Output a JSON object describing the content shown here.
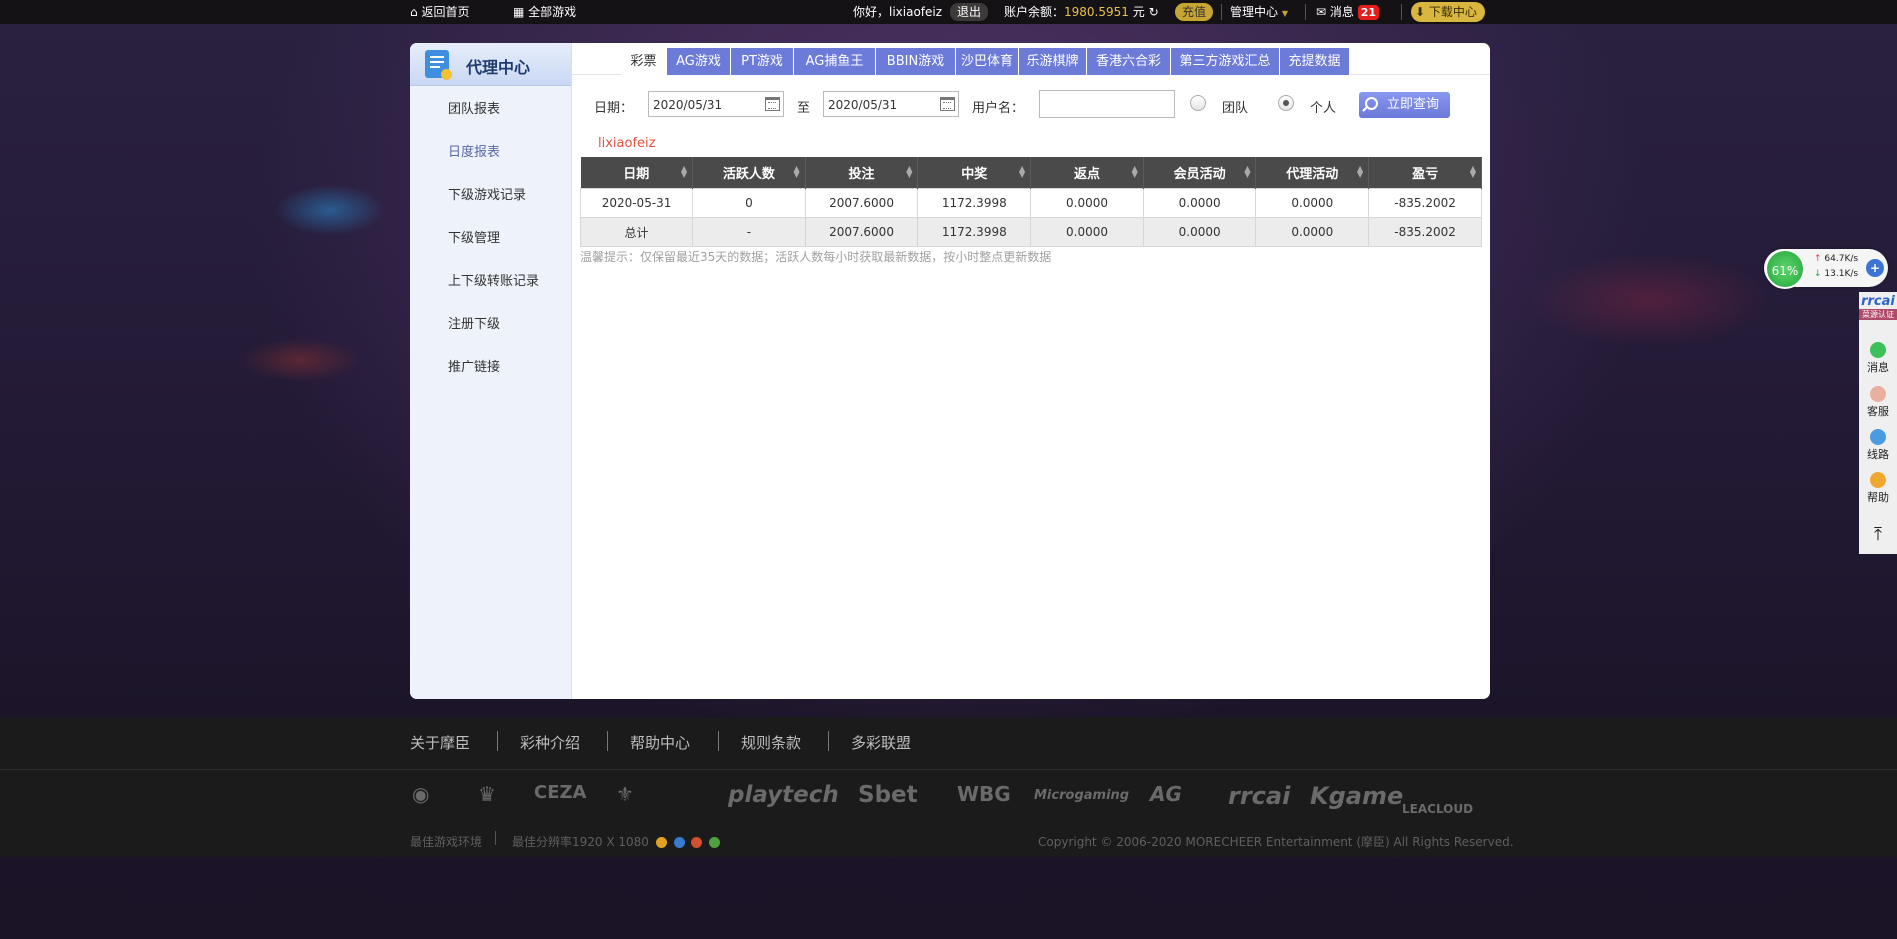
{
  "topbar": {
    "home": "返回首页",
    "all_games": "全部游戏",
    "greeting": "你好，lixiaofeiz",
    "logout": "退出",
    "balance_label": "账户余额：",
    "balance_value": "1980.5951",
    "balance_unit": "元",
    "charge": "充值",
    "manage": "管理中心",
    "messages": "消息",
    "message_count": "21",
    "download": "下载中心"
  },
  "sidebar": {
    "title": "代理中心",
    "items": [
      "团队报表",
      "日度报表",
      "下级游戏记录",
      "下级管理",
      "上下级转账记录",
      "注册下级",
      "推广链接"
    ],
    "active_index": 1
  },
  "tabs": [
    "彩票",
    "AG游戏",
    "PT游戏",
    "AG捕鱼王",
    "BBIN游戏",
    "沙巴体育",
    "乐游棋牌",
    "香港六合彩",
    "第三方游戏汇总",
    "充提数据"
  ],
  "filter": {
    "date_label": "日期：",
    "date_from": "2020/05/31",
    "to_label": "至",
    "date_to": "2020/05/31",
    "username_label": "用户名：",
    "username_value": "",
    "radio_team": "团队",
    "radio_personal": "个人",
    "selected": "个人",
    "query_button": "立即查询"
  },
  "user_link": "lixiaofeiz",
  "table": {
    "columns": [
      "日期",
      "活跃人数",
      "投注",
      "中奖",
      "返点",
      "会员活动",
      "代理活动",
      "盈亏"
    ],
    "rows": [
      [
        "2020-05-31",
        "0",
        "2007.6000",
        "1172.3998",
        "0.0000",
        "0.0000",
        "0.0000",
        "-835.2002"
      ]
    ],
    "total": [
      "总计",
      "-",
      "2007.6000",
      "1172.3998",
      "0.0000",
      "0.0000",
      "0.0000",
      "-835.2002"
    ]
  },
  "tip": "温馨提示：仅保留最近35天的数据；活跃人数每小时获取最新数据，按小时整点更新数据",
  "speed_widget": {
    "percent": "61%",
    "up": "64.7K/s",
    "down": "13.1K/s"
  },
  "rightbar": {
    "brand": "rrcai",
    "brand_sub": "菜源认证",
    "items": [
      "消息",
      "客服",
      "线路",
      "帮助"
    ]
  },
  "footer": {
    "links": [
      "关于摩臣",
      "彩种介绍",
      "帮助中心",
      "规则条款",
      "多彩联盟"
    ],
    "logos": [
      "CEZA",
      "playtech",
      "Sbet",
      "WBG",
      "Microgaming",
      "AG",
      "rrcai",
      "Kgame",
      "LEACLOUD"
    ],
    "env": "最佳游戏环境",
    "resolution": "最佳分辨率1920 X 1080",
    "copyright": "Copyright © 2006-2020 MORECHEER Entertainment (摩臣) All Rights Reserved."
  },
  "colors": {
    "tab_blue": "#6c7ad8",
    "header_dark": "#4a4a4a",
    "accent_gold": "#e9c247",
    "user_red": "#e0523e"
  }
}
